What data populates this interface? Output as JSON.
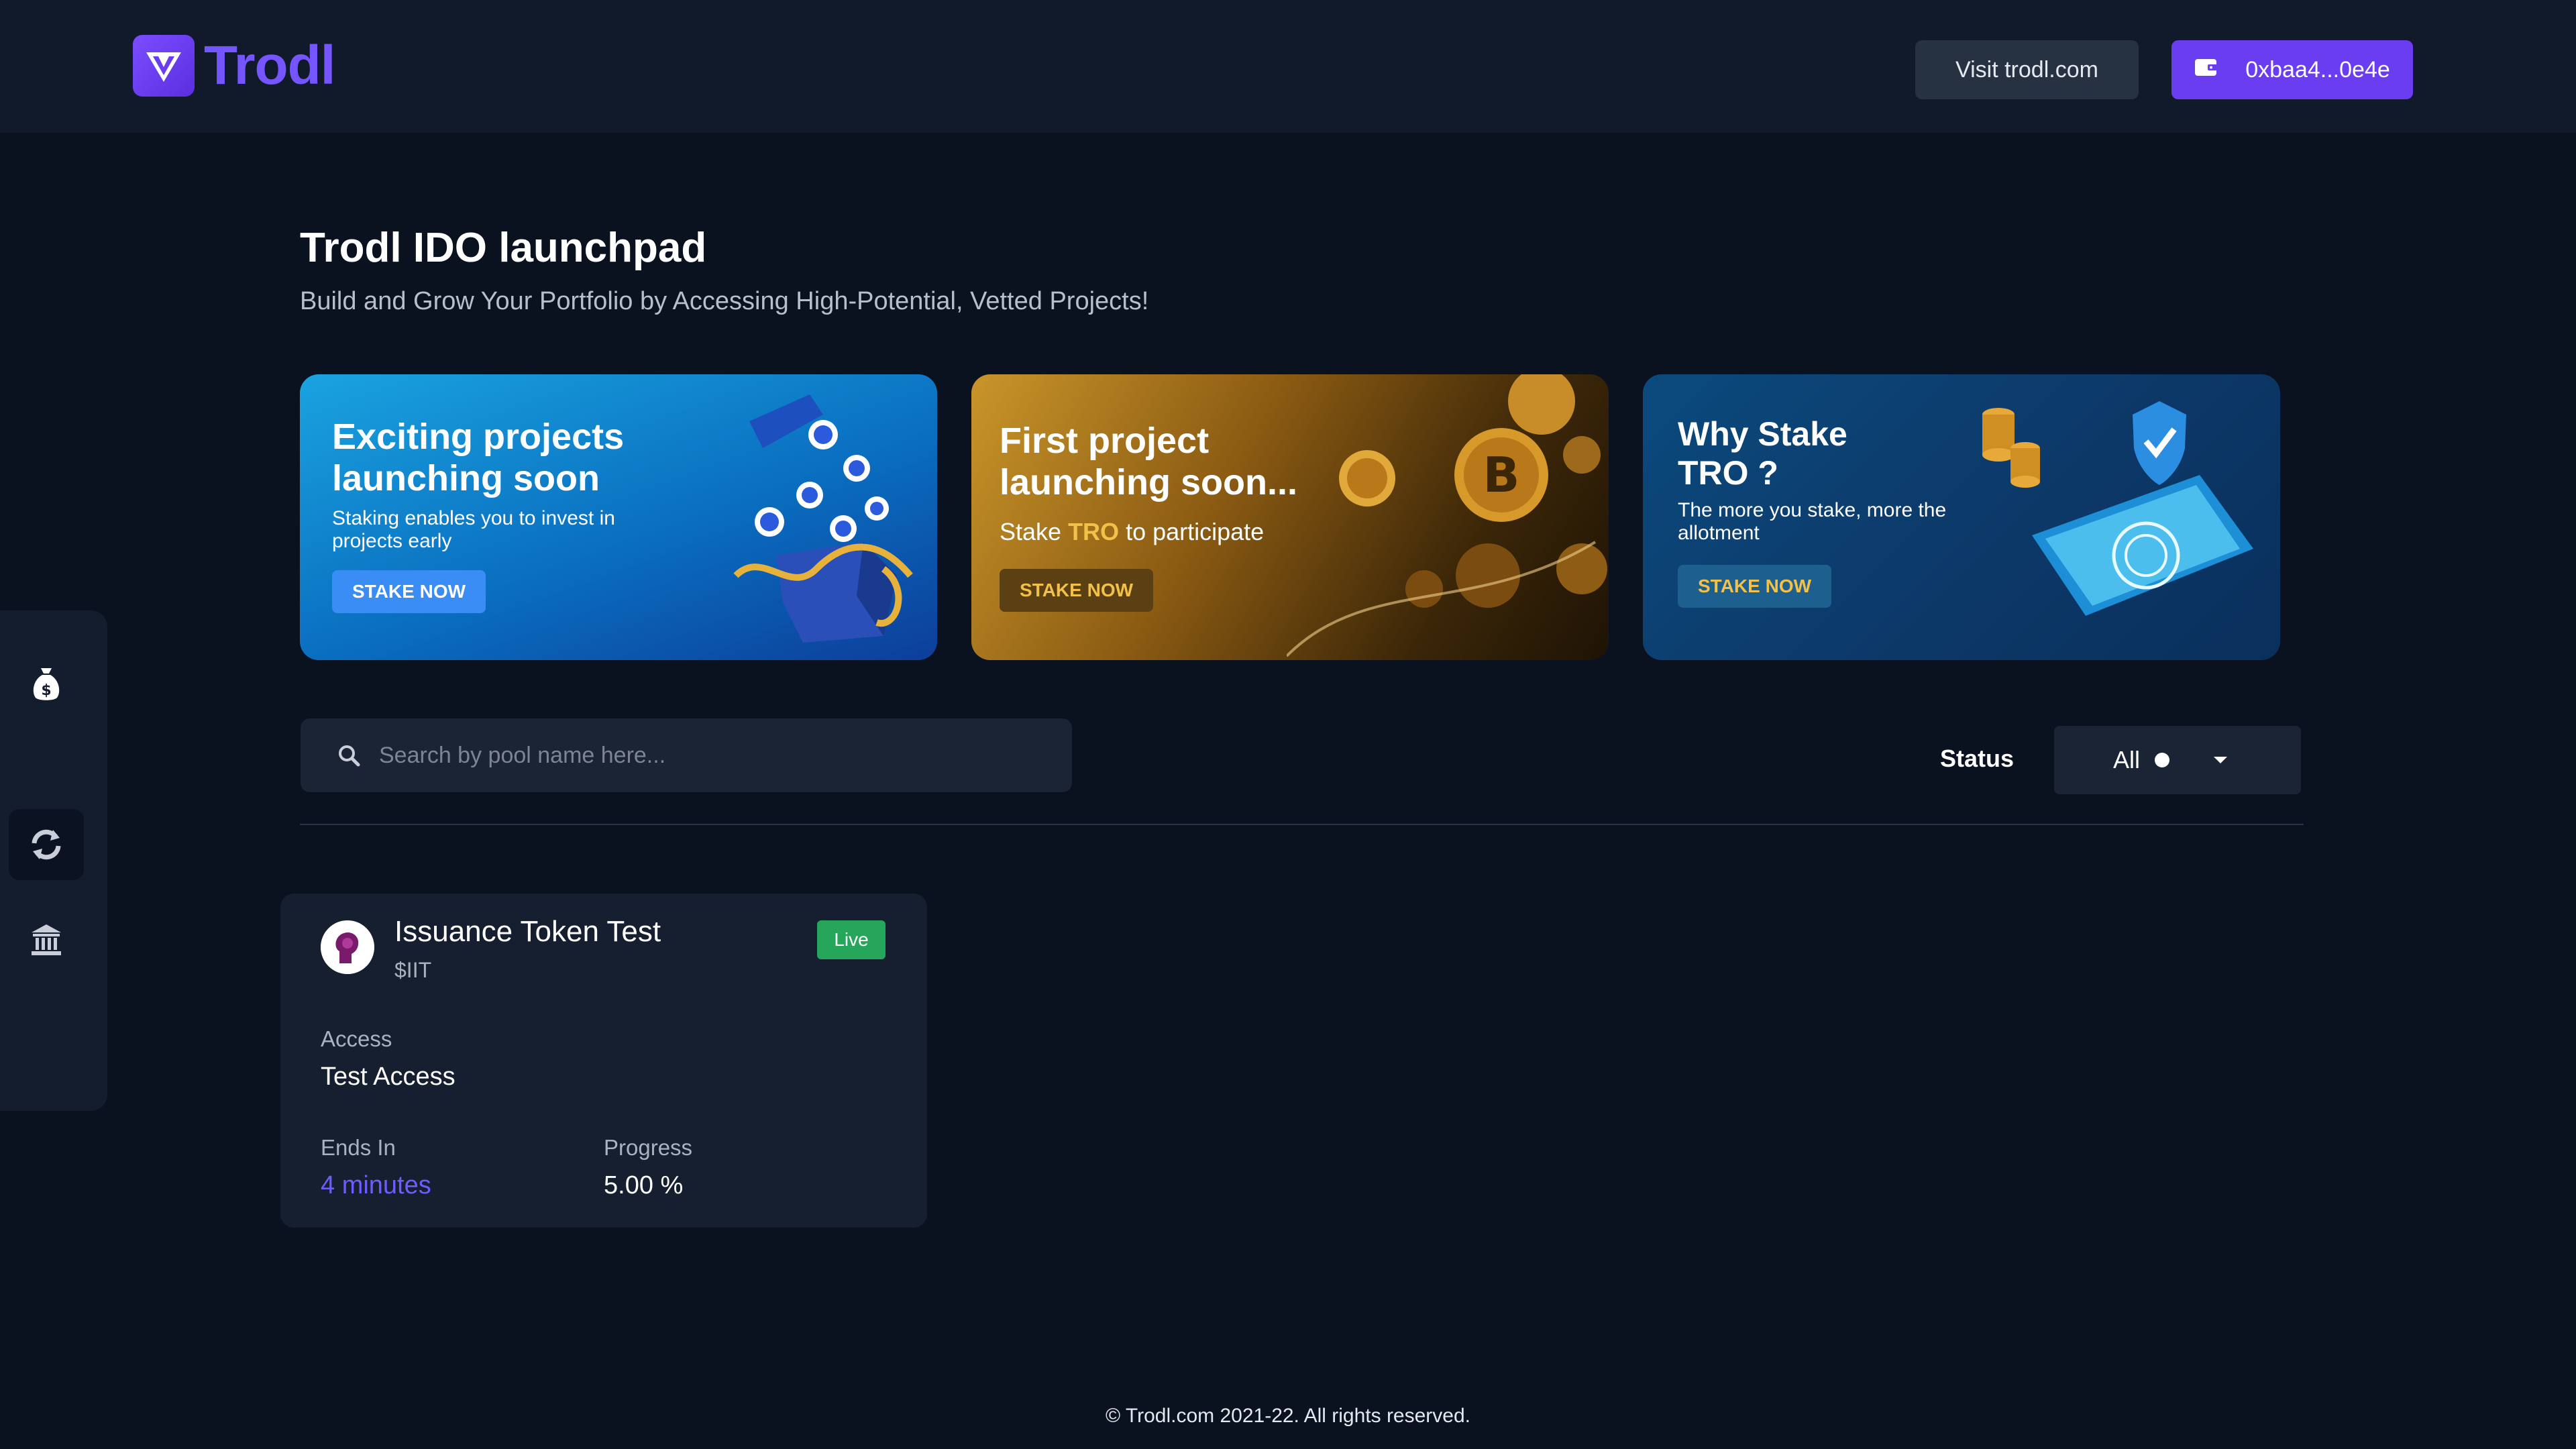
{
  "header": {
    "brand": "Trodl",
    "visit_label": "Visit trodl.com",
    "wallet_label": "0xbaa4...0e4e"
  },
  "sidebar": {
    "items": [
      {
        "icon": "money-bag-icon"
      },
      {
        "icon": "swap-icon",
        "active": true
      },
      {
        "icon": "bank-icon"
      }
    ]
  },
  "page": {
    "title": "Trodl IDO launchpad",
    "subtitle": "Build and Grow Your Portfolio by Accessing High-Potential, Vetted Projects!"
  },
  "banners": [
    {
      "heading": "Exciting projects launching soon",
      "text": "Staking enables you to invest in projects early",
      "cta": "STAKE NOW"
    },
    {
      "heading": "First project launching soon...",
      "text_pre": "Stake ",
      "text_highlight": "TRO",
      "text_post": " to participate",
      "cta": "STAKE NOW"
    },
    {
      "heading": "Why Stake TRO ?",
      "text": "The more you stake, more the allotment",
      "cta": "STAKE NOW"
    }
  ],
  "filters": {
    "search_placeholder": "Search by pool name here...",
    "status_label": "Status",
    "status_value": "All"
  },
  "pools": [
    {
      "name": "Issuance Token Test",
      "symbol": "$IIT",
      "badge": "Live",
      "access_label": "Access",
      "access_value": "Test Access",
      "ends_label": "Ends In",
      "ends_value": "4 minutes",
      "progress_label": "Progress",
      "progress_value": "5.00 %"
    }
  ],
  "footer": "© Trodl.com 2021-22. All rights reserved.",
  "colors": {
    "background": "#0a1220",
    "accent": "#6a3df0",
    "live": "#26a65b"
  }
}
